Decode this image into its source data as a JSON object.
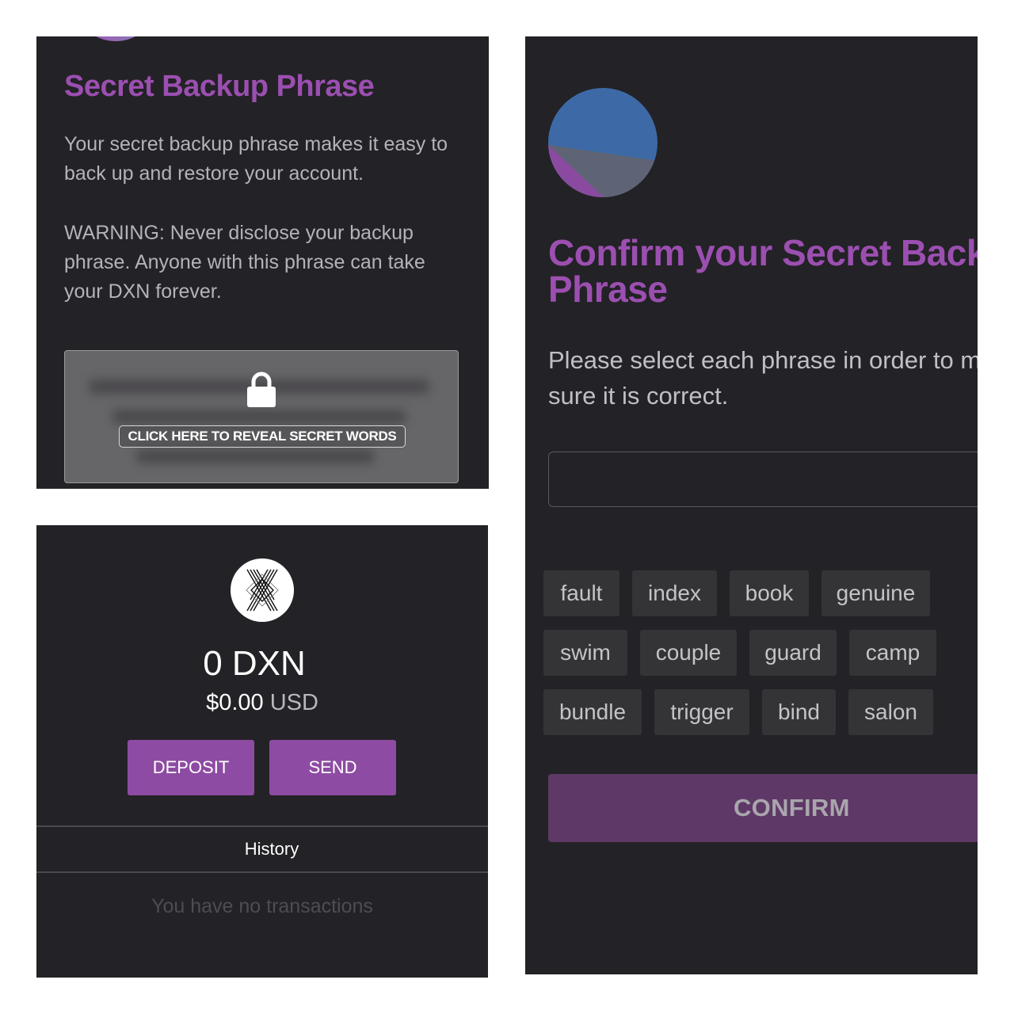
{
  "backup_screen": {
    "title": "Secret Backup Phrase",
    "description": "Your secret backup phrase makes it easy to back up and restore your account.",
    "warning": "WARNING: Never disclose your backup phrase. Anyone with this phrase can take your DXN forever.",
    "reveal_label": "CLICK HERE TO REVEAL SECRET WORDS",
    "icons": [
      "lock-icon"
    ]
  },
  "wallet_screen": {
    "balance": "0 DXN",
    "usd_value": "$0.00",
    "usd_unit": "USD",
    "deposit_label": "DEPOSIT",
    "send_label": "SEND",
    "history_label": "History",
    "empty_message": "You have no transactions",
    "icons": [
      "dxn-logo-icon"
    ]
  },
  "confirm_screen": {
    "title_line1": "Confirm your Secret Back",
    "title_line2": "Phrase",
    "instruction": "Please select each phrase in order to m sure it is correct.",
    "words": [
      "fault",
      "index",
      "book",
      "genuine",
      "swim",
      "couple",
      "guard",
      "camp",
      "bundle",
      "trigger",
      "bind",
      "salon"
    ],
    "confirm_label": "CONFIRM",
    "icons": [
      "account-avatar-icon"
    ]
  },
  "colors": {
    "panel_bg": "#232226",
    "accent_purple": "#9b4fb0",
    "button_purple": "#8e4ba3",
    "confirm_disabled": "#5e3866",
    "word_chip": "#343336"
  }
}
